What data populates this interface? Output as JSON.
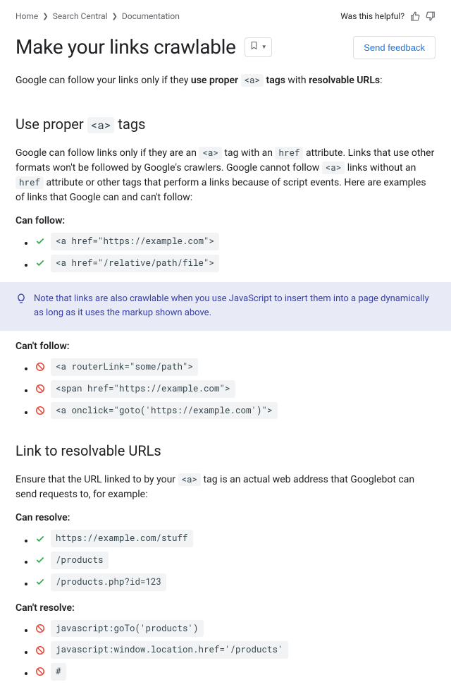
{
  "breadcrumbs": {
    "home": "Home",
    "search_central": "Search Central",
    "documentation": "Documentation"
  },
  "helpful_label": "Was this helpful?",
  "title": "Make your links crawlable",
  "feedback_button": "Send feedback",
  "intro": {
    "p1a": "Google can follow your links only if they ",
    "p1b": "use proper ",
    "p1c": " tags",
    "p1d": " with ",
    "p1e": "resolvable URLs",
    "p1f": ":",
    "code_a": "<a>"
  },
  "section1": {
    "heading_a": "Use proper ",
    "heading_b": " tags",
    "code_a": "<a>",
    "p_a": "Google can follow links only if they are an ",
    "p_b": " tag with an ",
    "p_c": " attribute. Links that use other formats won't be followed by Google's crawlers. Google cannot follow ",
    "p_d": " links without an ",
    "p_e": " attribute or other tags that perform a links because of script events. Here are examples of links that Google can and can't follow:",
    "code_href": "href",
    "can_follow_label": "Can follow:",
    "can_follow": [
      "<a href=\"https://example.com\">",
      "<a href=\"/relative/path/file\">"
    ],
    "note": "Note that links are also crawlable when you use JavaScript to insert them into a page dynamically as long as it uses the markup shown above.",
    "cant_follow_label": "Can't follow:",
    "cant_follow": [
      "<a routerLink=\"some/path\">",
      "<span href=\"https://example.com\">",
      "<a onclick=\"goto('https://example.com')\">"
    ]
  },
  "section2": {
    "heading": "Link to resolvable URLs",
    "p_a": "Ensure that the URL linked to by your ",
    "p_b": " tag is an actual web address that Googlebot can send requests to, for example:",
    "code_a": "<a>",
    "can_resolve_label": "Can resolve:",
    "can_resolve": [
      "https://example.com/stuff",
      "/products",
      "/products.php?id=123"
    ],
    "cant_resolve_label": "Can't resolve:",
    "cant_resolve": [
      "javascript:goTo('products')",
      "javascript:window.location.href='/products'",
      "#"
    ]
  }
}
